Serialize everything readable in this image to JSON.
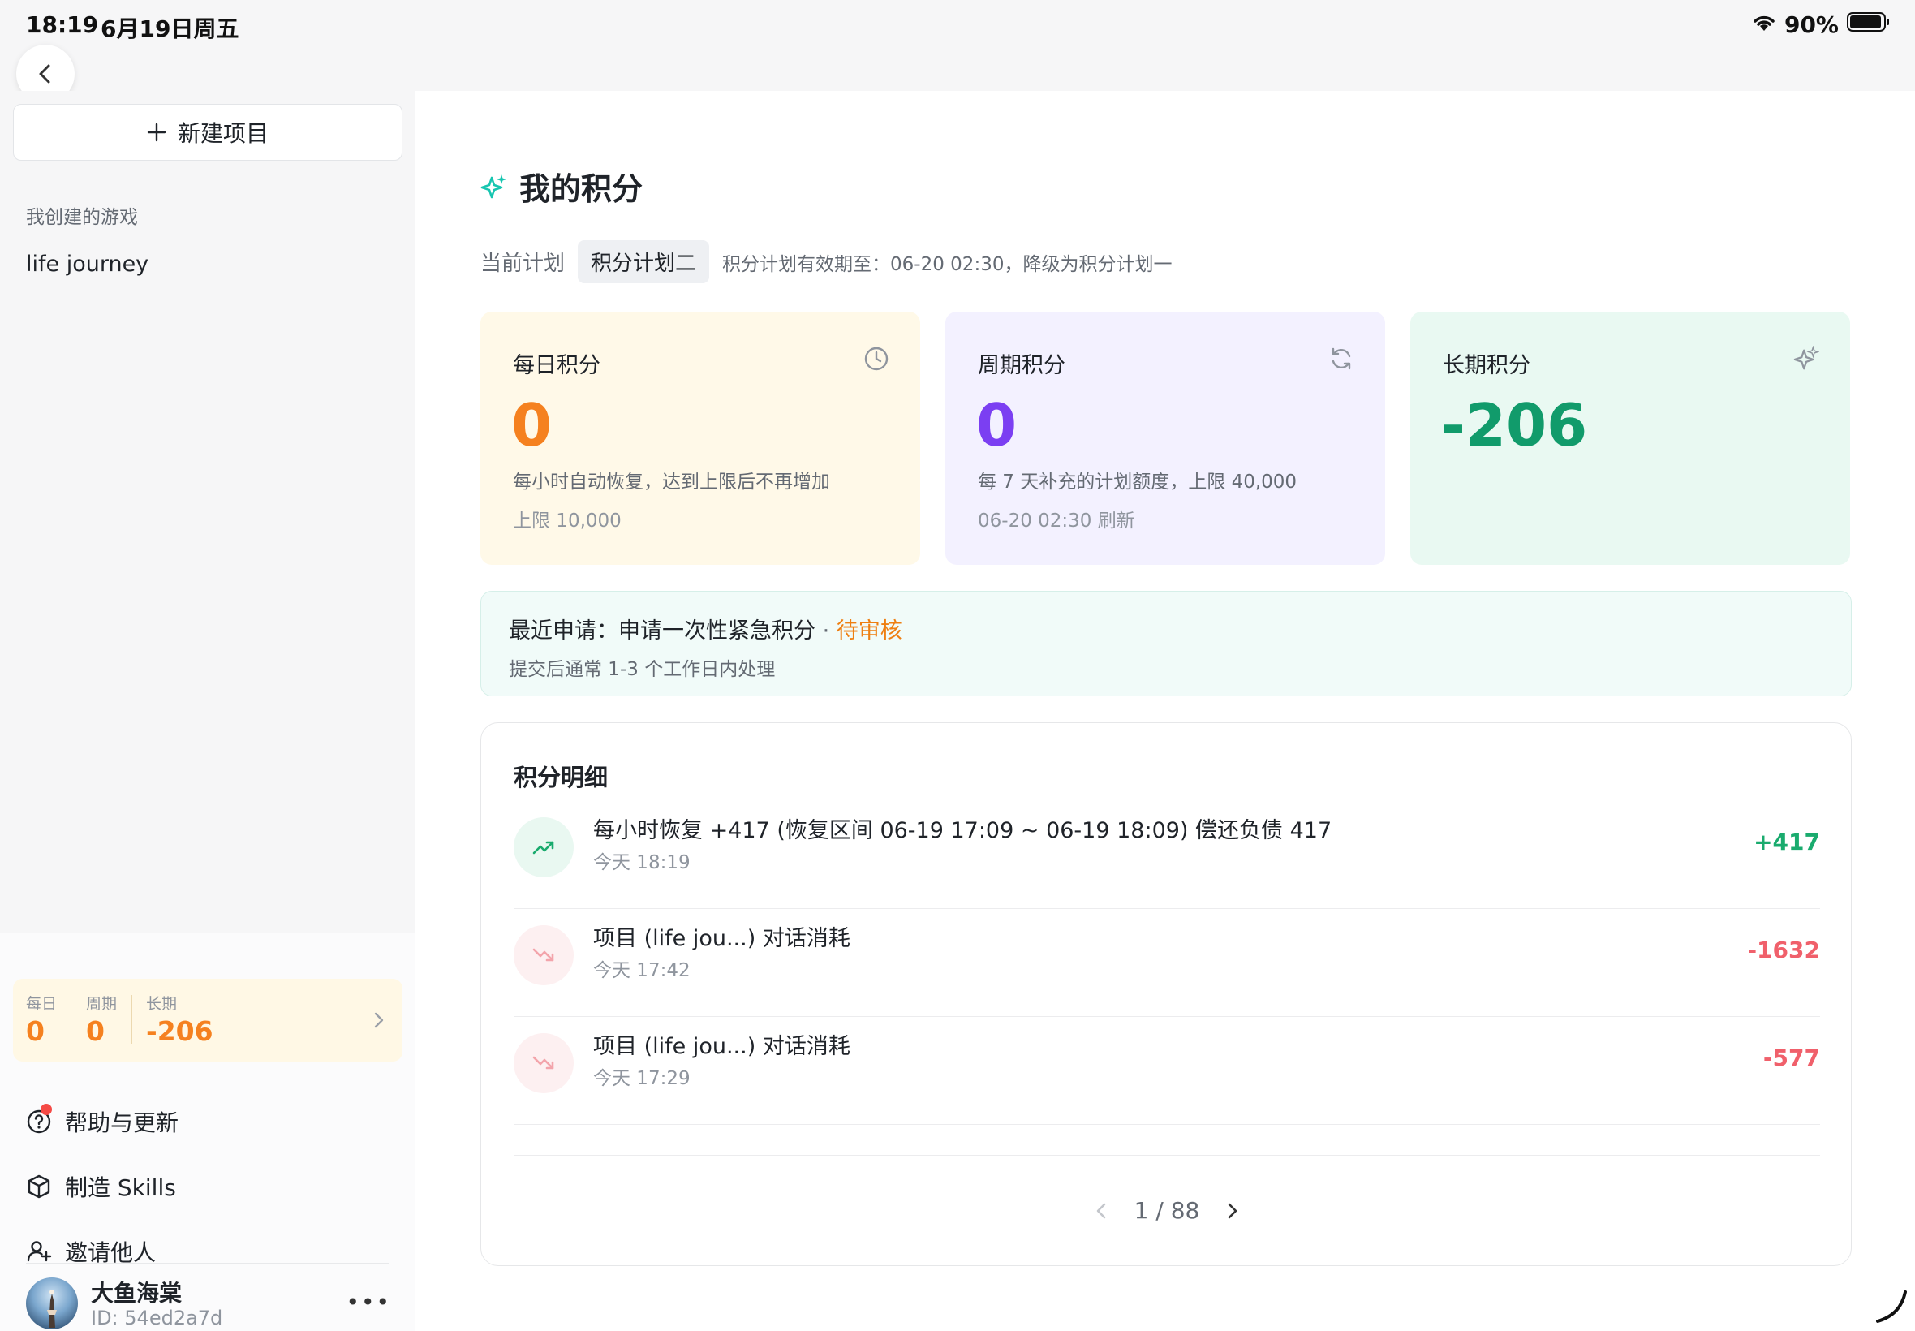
{
  "status_bar": {
    "time": "18:19",
    "date": "6月19日周五",
    "battery": "90%"
  },
  "sidebar": {
    "new_project_label": "新建项目",
    "section_label": "我创建的游戏",
    "games": [
      {
        "label": "life journey"
      }
    ],
    "points_summary": {
      "daily_label": "每日",
      "daily_value": "0",
      "period_label": "周期",
      "period_value": "0",
      "long_label": "长期",
      "long_value": "-206"
    },
    "menu": [
      {
        "label": "帮助与更新",
        "icon": "help-circle-icon"
      },
      {
        "label": "制造 Skills",
        "icon": "cube-icon"
      },
      {
        "label": "邀请他人",
        "icon": "user-plus-icon"
      }
    ],
    "user": {
      "name": "大鱼海棠",
      "id": "ID: 54ed2a7d"
    }
  },
  "main": {
    "title": "我的积分",
    "plan": {
      "label": "当前计划",
      "current": "积分计划二",
      "note": "积分计划有效期至：06-20 02:30，降级为积分计划一"
    },
    "cards": {
      "daily": {
        "title": "每日积分",
        "value": "0",
        "desc": "每小时自动恢复，达到上限后不再增加",
        "sub": "上限 10,000",
        "color": "#f5811f",
        "bg": "#fff9e8",
        "icon": "clock-icon"
      },
      "period": {
        "title": "周期积分",
        "value": "0",
        "desc": "每 7 天补充的计划额度，上限 40,000",
        "sub": "06-20 02:30 刷新",
        "color": "#7b3ff2",
        "bg": "#f3f1ff",
        "icon": "refresh-icon"
      },
      "long": {
        "title": "长期积分",
        "value": "-206",
        "color": "#119b6b",
        "bg": "#e9f9f2",
        "icon": "sparkle-icon"
      }
    },
    "notice": {
      "prefix": "最近申请：",
      "request": "申请一次性紧急积分",
      "sep": " · ",
      "status": "待审核",
      "status_color": "#ee7f12",
      "hint": "提交后通常 1-3 个工作日内处理"
    },
    "detail": {
      "title": "积分明细",
      "rows": [
        {
          "title": "每小时恢复 +417 (恢复区间 06-19 17:09 ~ 06-19 18:09) 偿还负债 417",
          "time": "今天 18:19",
          "amount": "+417",
          "type": "up"
        },
        {
          "title": "项目 (life jou...) 对话消耗",
          "time": "今天 17:42",
          "amount": "-1632",
          "type": "down"
        },
        {
          "title": "项目 (life jou...) 对话消耗",
          "time": "今天 17:29",
          "amount": "-577",
          "type": "down"
        }
      ],
      "pager": {
        "text": "1 / 88"
      }
    }
  },
  "colors": {
    "up_green": "#1aab6e",
    "down_red": "#f0606b",
    "accent_teal": "#17c5b0"
  }
}
